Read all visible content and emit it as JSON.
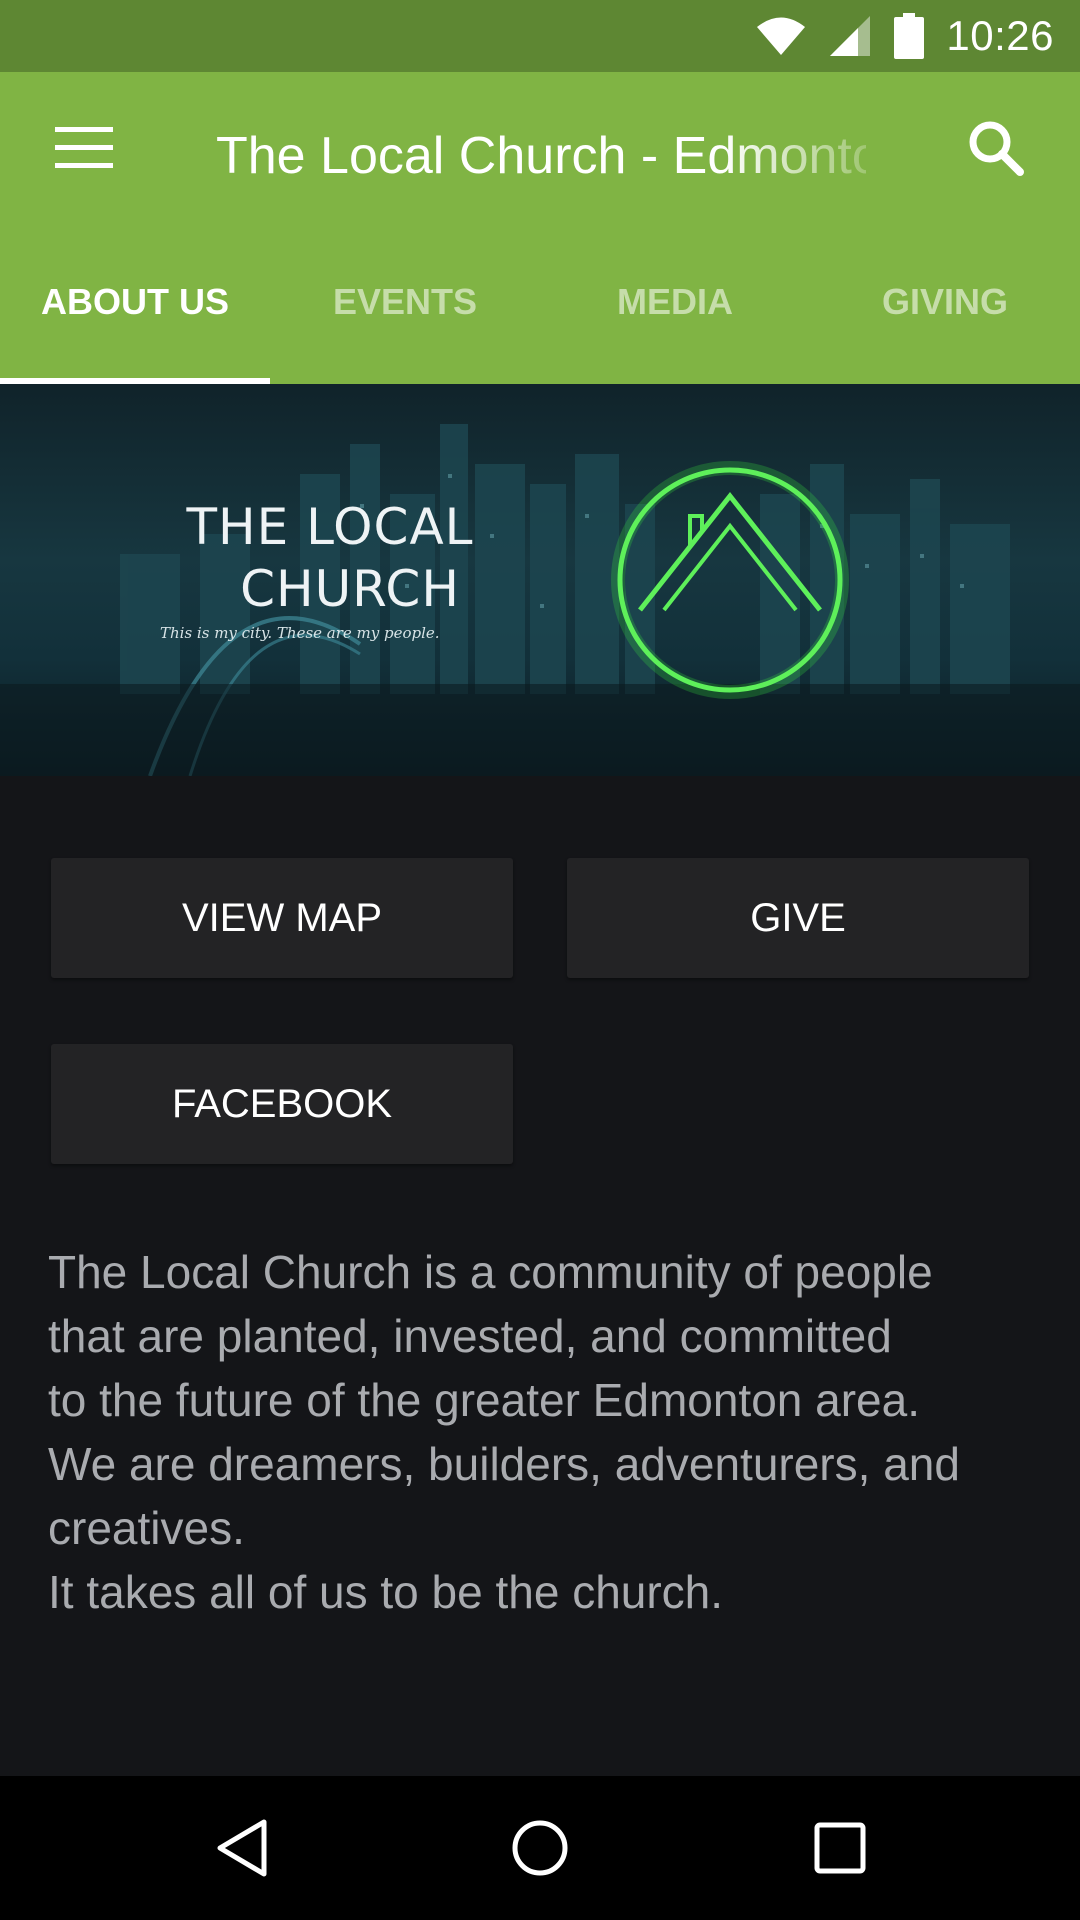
{
  "status_bar": {
    "time": "10:26",
    "icons": [
      "wifi-icon",
      "cell-signal-icon",
      "battery-icon"
    ]
  },
  "app_bar": {
    "title": "The Local Church - Edmonton",
    "menu_icon": "hamburger-menu-icon",
    "search_icon": "search-icon"
  },
  "tabs": [
    {
      "label": "ABOUT US",
      "active": true
    },
    {
      "label": "EVENTS",
      "active": false
    },
    {
      "label": "MEDIA",
      "active": false
    },
    {
      "label": "GIVING",
      "active": false
    }
  ],
  "banner": {
    "line1": "THE LOCAL",
    "line2": "CHURCH",
    "tagline": "This is my city. These are my people.",
    "logo_color": "#39e23a"
  },
  "buttons": {
    "view_map": "VIEW MAP",
    "give": "GIVE",
    "facebook": "FACEBOOK"
  },
  "description": {
    "lines": [
      "The Local Church is a community of people",
      "that are planted, invested, and committed",
      "to the future of the greater Edmonton area.",
      "We are dreamers, builders, adventurers, and",
      "creatives.",
      "It takes all of us to be the church."
    ]
  },
  "nav_bar": {
    "icons": [
      "back-icon",
      "home-icon",
      "recent-apps-icon"
    ]
  },
  "colors": {
    "status_bar": "#5e8733",
    "app_bar": "#80b444",
    "background": "#141518",
    "button": "#232325"
  }
}
